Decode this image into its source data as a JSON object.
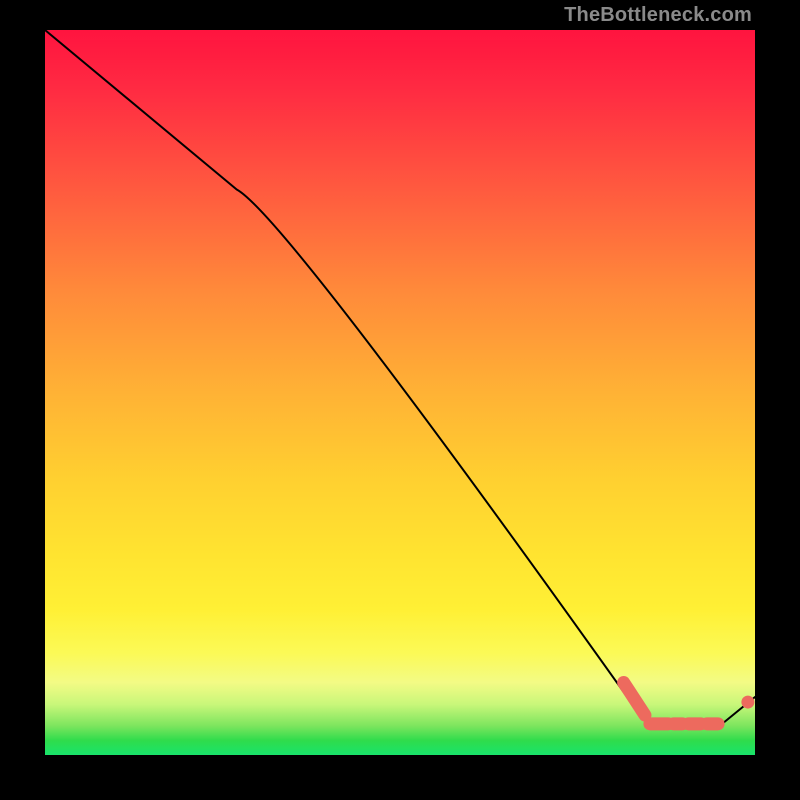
{
  "credit": "TheBottleneck.com",
  "chart_data": {
    "type": "line",
    "title": "",
    "xlabel": "",
    "ylabel": "",
    "xlim": [
      0,
      100
    ],
    "ylim": [
      0,
      100
    ],
    "grid": false,
    "series": [
      {
        "name": "main-curve",
        "color": "#000000",
        "points": [
          {
            "x": 0.0,
            "y": 100.0
          },
          {
            "x": 27.0,
            "y": 78.0
          },
          {
            "x": 82.0,
            "y": 8.0
          },
          {
            "x": 86.0,
            "y": 4.0
          },
          {
            "x": 95.0,
            "y": 4.0
          },
          {
            "x": 100.0,
            "y": 8.0
          }
        ]
      }
    ],
    "markers": [
      {
        "shape": "pill",
        "x0": 81.5,
        "y0": 10.0,
        "x1": 84.5,
        "y1": 5.5,
        "color": "#ed6a5e"
      },
      {
        "shape": "pill",
        "x0": 85.2,
        "y0": 4.3,
        "x1": 87.8,
        "y1": 4.3,
        "color": "#ed6a5e"
      },
      {
        "shape": "pill",
        "x0": 88.5,
        "y0": 4.3,
        "x1": 89.8,
        "y1": 4.3,
        "color": "#ed6a5e"
      },
      {
        "shape": "pill",
        "x0": 90.6,
        "y0": 4.3,
        "x1": 92.4,
        "y1": 4.3,
        "color": "#ed6a5e"
      },
      {
        "shape": "pill",
        "x0": 93.2,
        "y0": 4.3,
        "x1": 94.8,
        "y1": 4.3,
        "color": "#ed6a5e"
      },
      {
        "shape": "dot",
        "x": 99.0,
        "y": 7.3,
        "color": "#ed6a5e"
      }
    ]
  }
}
